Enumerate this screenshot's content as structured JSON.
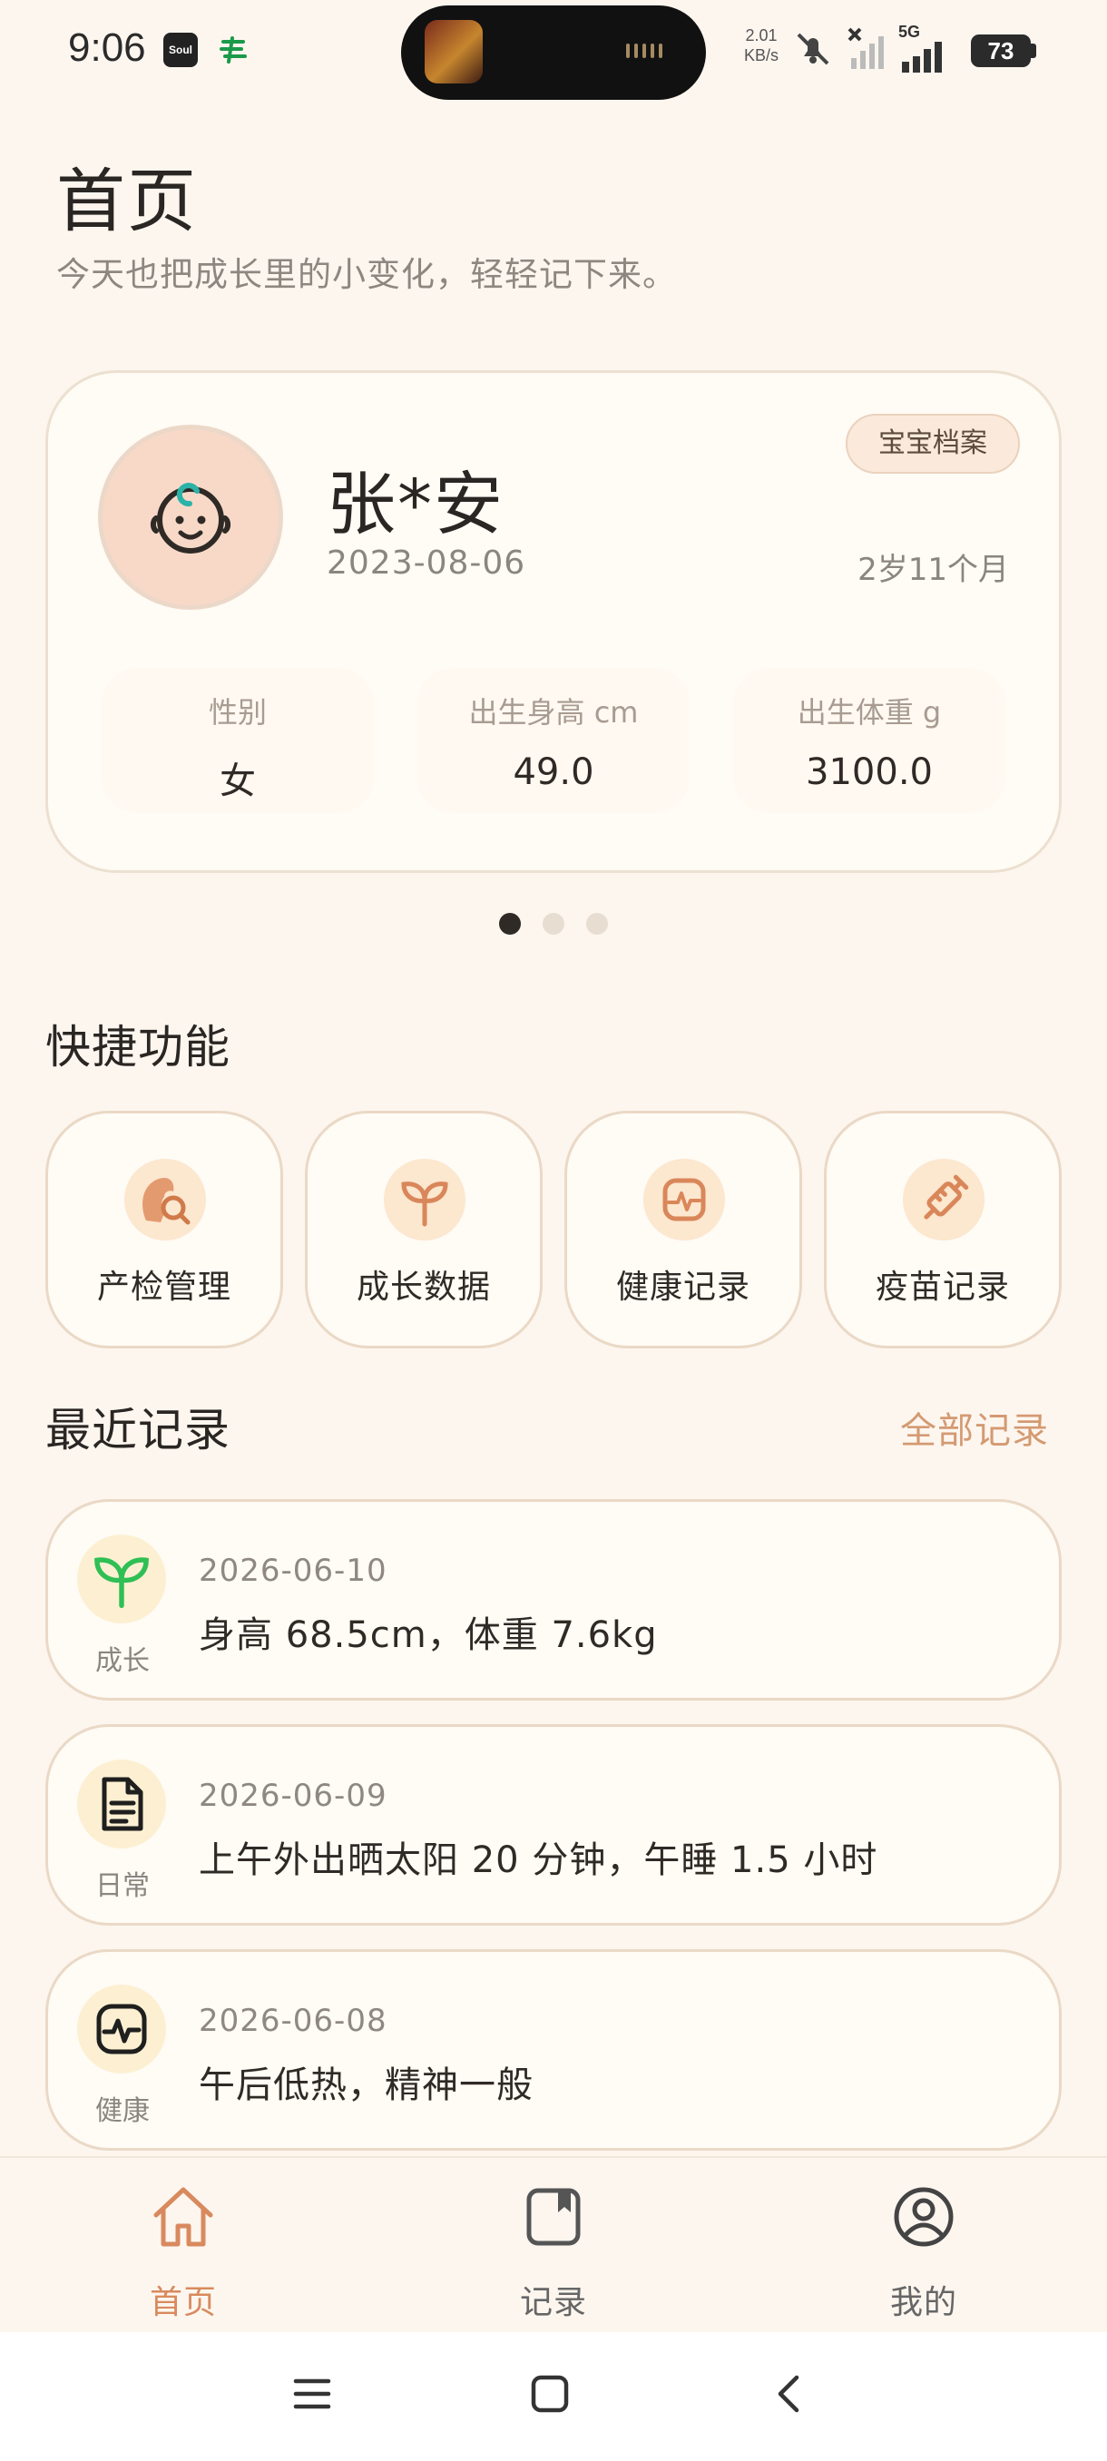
{
  "status_bar": {
    "time": "9:06",
    "net_speed_value": "2.01",
    "net_speed_unit": "KB/s",
    "network_type": "5G",
    "battery": "73",
    "icons": [
      "soul-app-icon",
      "postal-app-icon",
      "media-thumbnail",
      "mute-icon",
      "wifi-off-icon",
      "signal-icon",
      "battery-icon"
    ]
  },
  "header": {
    "title": "首页",
    "subtitle": "今天也把成长里的小变化，轻轻记下来。"
  },
  "profile": {
    "badge": "宝宝档案",
    "name": "张*安",
    "birth_date": "2023-08-06",
    "age": "2岁11个月",
    "stats": [
      {
        "label": "性别",
        "value": "女"
      },
      {
        "label": "出生身高 cm",
        "value": "49.0"
      },
      {
        "label": "出生体重 g",
        "value": "3100.0"
      }
    ],
    "carousel_active_index": 0,
    "carousel_count": 3
  },
  "quick": {
    "title": "快捷功能",
    "items": [
      {
        "label": "产检管理",
        "icon": "prenatal-check-icon"
      },
      {
        "label": "成长数据",
        "icon": "sprout-icon"
      },
      {
        "label": "健康记录",
        "icon": "pulse-icon"
      },
      {
        "label": "疫苗记录",
        "icon": "syringe-icon"
      }
    ]
  },
  "recent": {
    "title": "最近记录",
    "all_link": "全部记录",
    "items": [
      {
        "type": "成长",
        "date": "2026-06-10",
        "text": "身高 68.5cm，体重 7.6kg",
        "icon": "sprout-icon"
      },
      {
        "type": "日常",
        "date": "2026-06-09",
        "text": "上午外出晒太阳 20 分钟，午睡 1.5 小时",
        "icon": "document-icon"
      },
      {
        "type": "健康",
        "date": "2026-06-08",
        "text": "午后低热，精神一般",
        "icon": "pulse-icon"
      }
    ]
  },
  "bottom_nav": {
    "items": [
      {
        "label": "首页",
        "icon": "home-icon",
        "active": true
      },
      {
        "label": "记录",
        "icon": "record-book-icon",
        "active": false
      },
      {
        "label": "我的",
        "icon": "profile-icon",
        "active": false
      }
    ]
  },
  "colors": {
    "background": "#fdf6ef",
    "accent": "#d49a72",
    "card_border": "#ead9c6",
    "sprout_green": "#2fbf55",
    "icon_bg": "#fce7cf"
  }
}
